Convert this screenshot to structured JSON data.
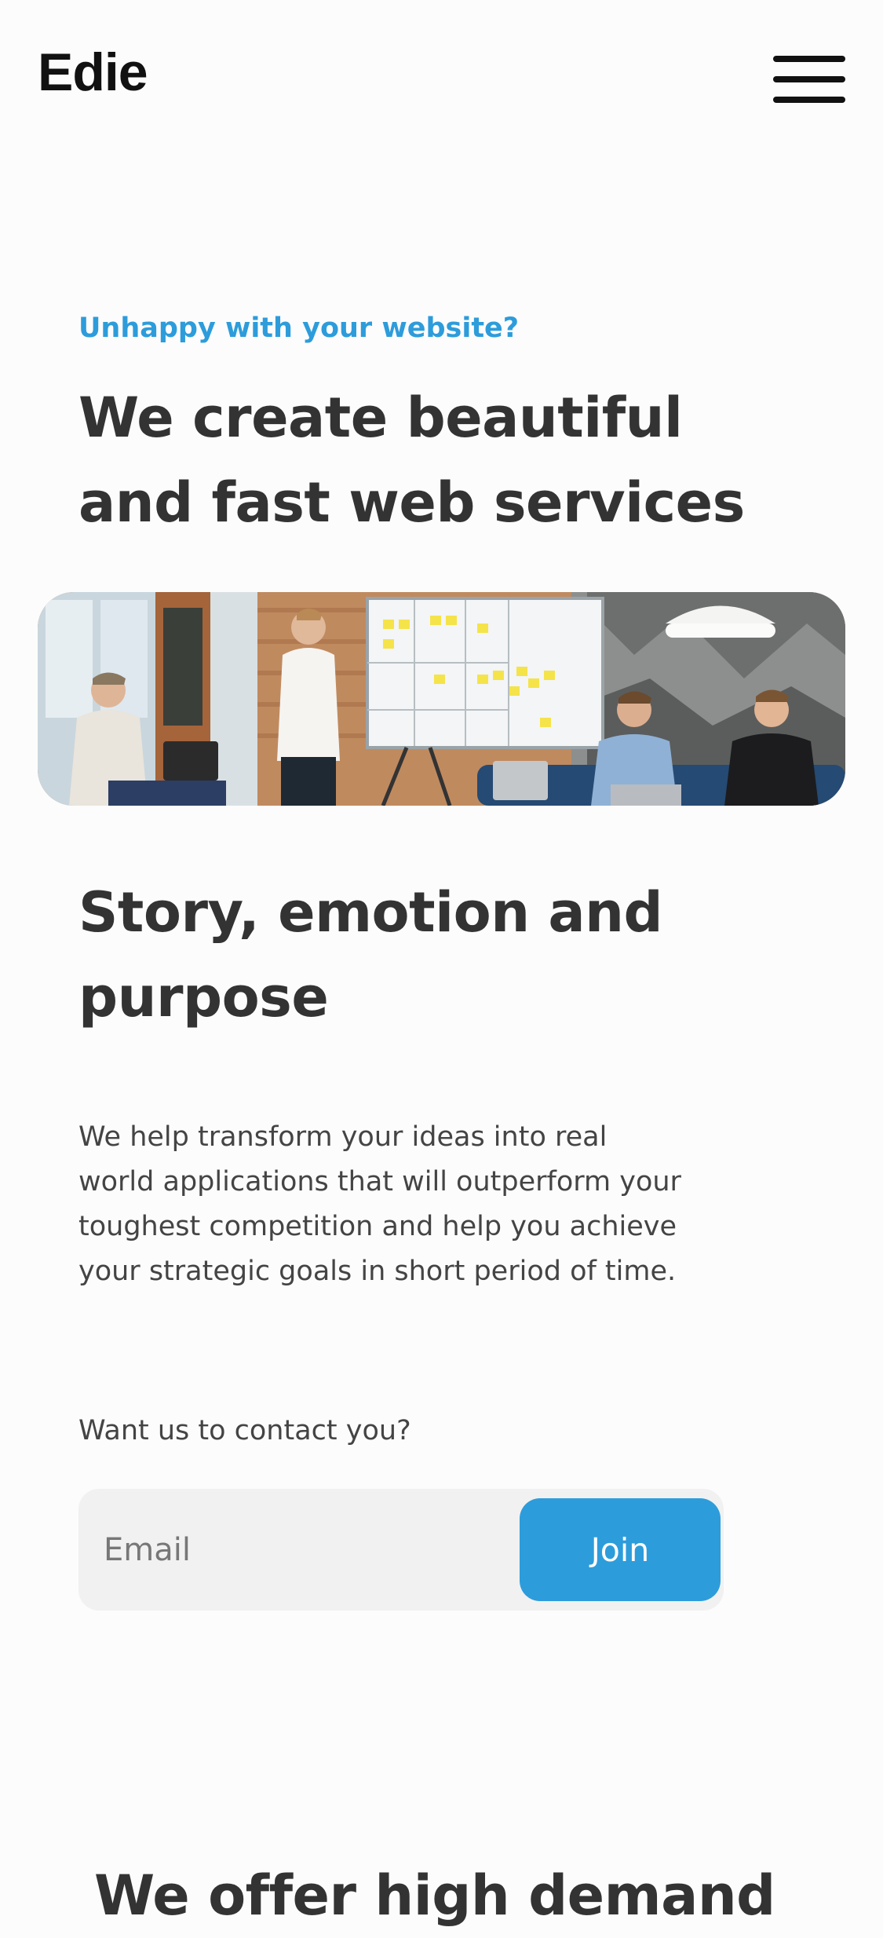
{
  "header": {
    "logo": "Edie",
    "menu_icon": "hamburger-menu-icon"
  },
  "hero": {
    "eyebrow": "Unhappy with your website?",
    "title_line1": "We create beautiful",
    "title_line2": "and fast web services",
    "image_alt": "team-meeting-photo"
  },
  "story": {
    "title_line1": "Story, emotion and",
    "title_line2": "purpose",
    "body": "We help transform your ideas into real world applications that will outperform your toughest competition and help you achieve your strategic goals in short period of time."
  },
  "contact": {
    "label": "Want us to contact you?",
    "email_placeholder": "Email",
    "join_label": "Join"
  },
  "next_section": {
    "title": "We offer high demand"
  },
  "colors": {
    "accent": "#2d9cdb",
    "text": "#333333",
    "input_bg": "#f1f1f1"
  }
}
